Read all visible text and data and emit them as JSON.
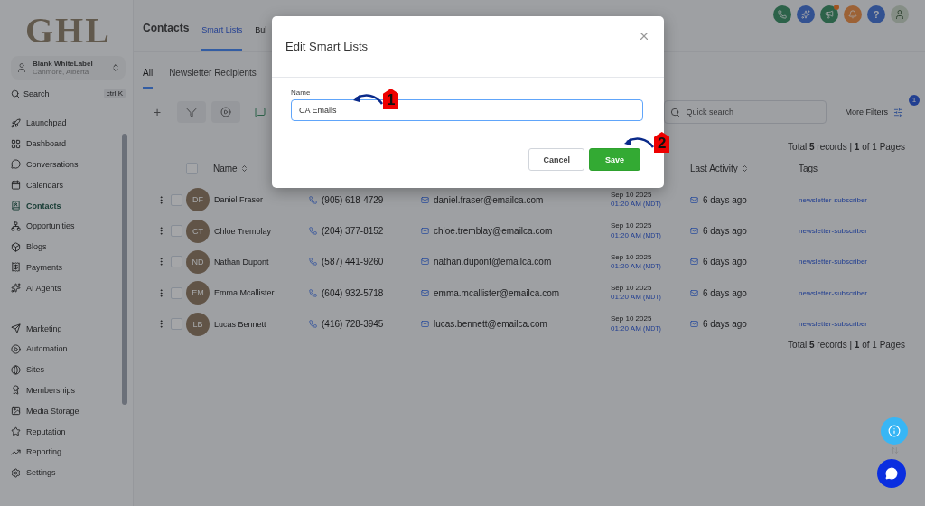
{
  "sidebar": {
    "logo": "GHL",
    "account": {
      "name": "Blank WhiteLabel",
      "location": "Canmore, Alberta"
    },
    "search": {
      "placeholder": "Search",
      "shortcut": "ctrl K"
    },
    "nav_groups": [
      [
        {
          "label": "Launchpad",
          "selected": false
        },
        {
          "label": "Dashboard",
          "selected": false
        },
        {
          "label": "Conversations",
          "selected": false
        },
        {
          "label": "Calendars",
          "selected": false
        },
        {
          "label": "Contacts",
          "selected": true
        },
        {
          "label": "Opportunities",
          "selected": false
        },
        {
          "label": "Blogs",
          "selected": false
        },
        {
          "label": "Payments",
          "selected": false
        },
        {
          "label": "AI Agents",
          "selected": false
        }
      ],
      [
        {
          "label": "Marketing",
          "selected": false
        },
        {
          "label": "Automation",
          "selected": false
        },
        {
          "label": "Sites",
          "selected": false
        },
        {
          "label": "Memberships",
          "selected": false
        },
        {
          "label": "Media Storage",
          "selected": false
        },
        {
          "label": "Reputation",
          "selected": false
        },
        {
          "label": "Reporting",
          "selected": false
        },
        {
          "label": "Settings",
          "selected": false
        }
      ]
    ]
  },
  "header": {
    "title": "Contacts",
    "tabs": [
      {
        "label": "Smart Lists",
        "selected": true
      },
      {
        "label": "Bul",
        "selected": false
      }
    ],
    "help_label": "?"
  },
  "list_tabs": [
    {
      "label": "All",
      "selected": true
    },
    {
      "label": "Newsletter Recipients",
      "selected": false
    }
  ],
  "toolbar": {
    "add_label": "+",
    "search_placeholder": "Quick search",
    "more_filters": "More Filters",
    "filter_count": "1"
  },
  "summary_top": "Total **5** records | **1** of 1 Pages",
  "table": {
    "columns": [
      "Name",
      "Last Activity",
      "Tags"
    ],
    "select_all_checked": false,
    "rows": [
      {
        "initials": "DF",
        "checked": false,
        "name": "Daniel Fraser",
        "phone": "(905) 618-4729",
        "email": "daniel.fraser@emailca.com",
        "date": "Sep 10 2025",
        "time": "01:20 AM",
        "zone": "(MDT)",
        "activity": "6 days ago",
        "tag": "newsletter-subscriber"
      },
      {
        "initials": "CT",
        "checked": false,
        "name": "Chloe Tremblay",
        "phone": "(204) 377-8152",
        "email": "chloe.tremblay@emailca.com",
        "date": "Sep 10 2025",
        "time": "01:20 AM",
        "zone": "(MDT)",
        "activity": "6 days ago",
        "tag": "newsletter-subscriber"
      },
      {
        "initials": "ND",
        "checked": false,
        "name": "Nathan Dupont",
        "phone": "(587) 441-9260",
        "email": "nathan.dupont@emailca.com",
        "date": "Sep 10 2025",
        "time": "01:20 AM",
        "zone": "(MDT)",
        "activity": "6 days ago",
        "tag": "newsletter-subscriber"
      },
      {
        "initials": "EM",
        "checked": false,
        "name": "Emma Mcallister",
        "phone": "(604) 932-5718",
        "email": "emma.mcallister@emailca.com",
        "date": "Sep 10 2025",
        "time": "01:20 AM",
        "zone": "(MDT)",
        "activity": "6 days ago",
        "tag": "newsletter-subscriber"
      },
      {
        "initials": "LB",
        "checked": false,
        "name": "Lucas Bennett",
        "phone": "(416) 728-3945",
        "email": "lucas.bennett@emailca.com",
        "date": "Sep 10 2025",
        "time": "01:20 AM",
        "zone": "(MDT)",
        "activity": "6 days ago",
        "tag": "newsletter-subscriber"
      }
    ]
  },
  "summary_bottom": "Total **5** records | **1** of 1 Pages",
  "dialog": {
    "title": "Edit Smart Lists",
    "field_label": "Name",
    "field_value": "CA Emails",
    "buttons": [
      "Cancel",
      "Save"
    ]
  },
  "annotations": [
    {
      "number": "1"
    },
    {
      "number": "2"
    }
  ]
}
